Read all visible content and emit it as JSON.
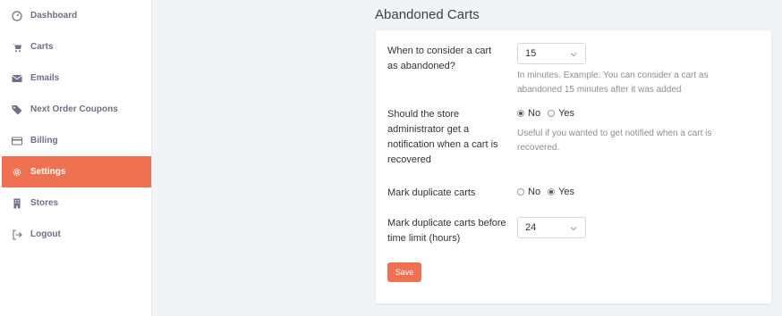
{
  "sidebar": {
    "items": [
      {
        "label": "Dashboard",
        "icon": "gauge-icon"
      },
      {
        "label": "Carts",
        "icon": "cart-icon"
      },
      {
        "label": "Emails",
        "icon": "envelope-icon"
      },
      {
        "label": "Next Order Coupons",
        "icon": "tags-icon"
      },
      {
        "label": "Billing",
        "icon": "credit-card-icon"
      },
      {
        "label": "Settings",
        "icon": "gear-icon",
        "active": true
      },
      {
        "label": "Stores",
        "icon": "building-icon"
      },
      {
        "label": "Logout",
        "icon": "logout-icon"
      }
    ],
    "active_color": "#f07152"
  },
  "main": {
    "title": "Abandoned Carts",
    "settings": {
      "abandon_time": {
        "label": "When to consider a cart as abandoned?",
        "value": "15",
        "help": "In minutes. Example: You can consider a cart as abandoned 15 minutes after it was added"
      },
      "notify_admin": {
        "label": "Should the store administrator get a notification when a cart is recovered",
        "options": [
          "No",
          "Yes"
        ],
        "selected": "No",
        "help": "Useful if you wanted to get notified when a cart is recovered."
      },
      "mark_duplicates": {
        "label": "Mark duplicate carts",
        "options": [
          "No",
          "Yes"
        ],
        "selected": "Yes"
      },
      "duplicate_time_limit": {
        "label": "Mark duplicate carts before time limit (hours)",
        "value": "24"
      }
    },
    "save_label": "Save"
  }
}
